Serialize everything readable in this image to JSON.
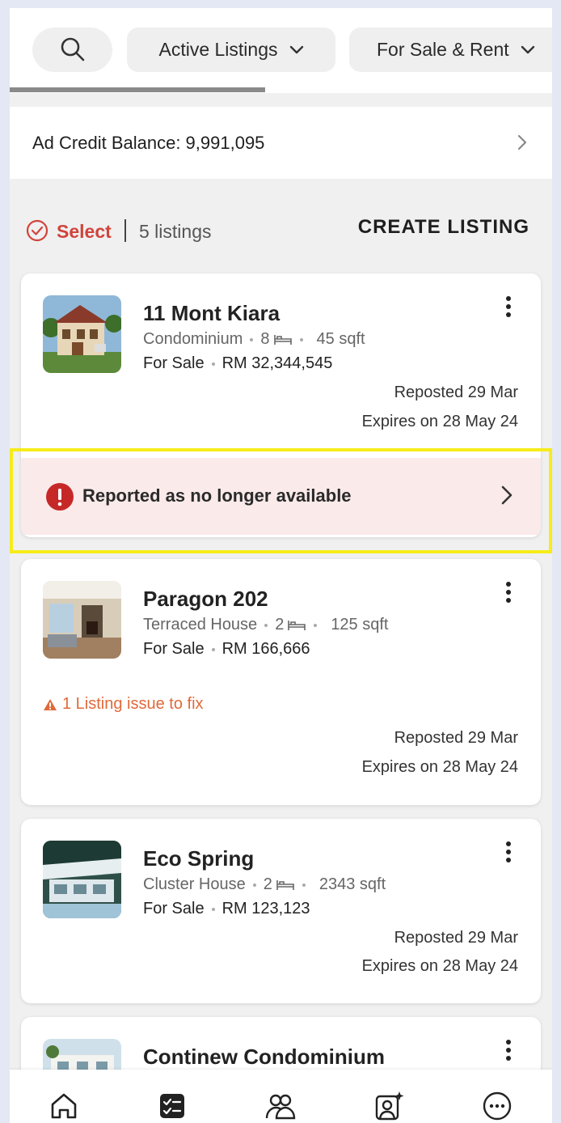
{
  "filters": {
    "status_label": "Active Listings",
    "type_label": "For Sale & Rent"
  },
  "credit": {
    "label": "Ad Credit Balance: 9,991,095"
  },
  "toolbar": {
    "select_label": "Select",
    "count_label": "5 listings",
    "create_label": "CREATE LISTING"
  },
  "listings": [
    {
      "title": "11 Mont Kiara",
      "property_type": "Condominium",
      "beds": "8",
      "size": "45 sqft",
      "listing_type": "For Sale",
      "price": "RM 32,344,545",
      "reposted": "Reposted 29 Mar",
      "expires": "Expires on 28 May 24",
      "report_label": "Reported as no longer available"
    },
    {
      "title": "Paragon 202",
      "property_type": "Terraced House",
      "beds": "2",
      "size": "125 sqft",
      "listing_type": "For Sale",
      "price": "RM 166,666",
      "issue_label": "1 Listing issue to fix",
      "reposted": "Reposted 29 Mar",
      "expires": "Expires on 28 May 24"
    },
    {
      "title": "Eco Spring",
      "property_type": "Cluster House",
      "beds": "2",
      "size": "2343 sqft",
      "listing_type": "For Sale",
      "price": "RM 123,123",
      "reposted": "Reposted 29 Mar",
      "expires": "Expires on 28 May 24"
    },
    {
      "title": "Continew Condominium"
    }
  ],
  "colors": {
    "accent_red": "#d0443c",
    "warning_orange": "#e0693a",
    "report_bg": "#fbeaea",
    "highlight": "#f6ec1a"
  },
  "nav_icons": [
    "home-icon",
    "listings-icon",
    "contacts-icon",
    "profile-sparkle-icon",
    "more-icon"
  ]
}
